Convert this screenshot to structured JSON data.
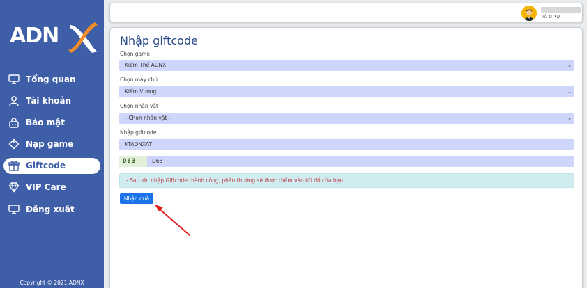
{
  "sidebar": {
    "logo_text": "ADN",
    "items": [
      {
        "label": "Tổng quan",
        "icon": "monitor-icon",
        "active": false
      },
      {
        "label": "Tài khoản",
        "icon": "user-icon",
        "active": false
      },
      {
        "label": "Bảo mật",
        "icon": "lock-icon",
        "active": false
      },
      {
        "label": "Nạp game",
        "icon": "tag-icon",
        "active": false
      },
      {
        "label": "Giftcode",
        "icon": "gift-icon",
        "active": true
      },
      {
        "label": "VIP Care",
        "icon": "diamond-icon",
        "active": false
      },
      {
        "label": "Đăng xuất",
        "icon": "monitor-icon",
        "active": false
      }
    ],
    "copyright": "Copyright © 2021 ADNX"
  },
  "header": {
    "balance": "Ví: 0 Xu"
  },
  "main": {
    "title": "Nhập giftcode",
    "fields": {
      "game": {
        "label": "Chọn game",
        "value": "Kiếm Thế ADNX"
      },
      "server": {
        "label": "Chọn máy chủ",
        "value": "Kiếm Vương"
      },
      "character": {
        "label": "Chọn nhân vật",
        "value": "--Chọn nhân vật--"
      },
      "giftcode": {
        "label": "Nhập giftcode",
        "value": "KTADNXAT"
      },
      "captcha": {
        "image_text": "D63",
        "value": "D63"
      }
    },
    "notice": "- Sau khi nhập Giftcode thành công, phần thưởng sẽ được thêm vào túi đồ của bạn.",
    "submit_label": "Nhận quà"
  },
  "colors": {
    "sidebar_bg": "#3f5ea8",
    "input_bg": "#cfd6fb",
    "button_bg": "#1a73e8",
    "arrow": "#e02020"
  }
}
